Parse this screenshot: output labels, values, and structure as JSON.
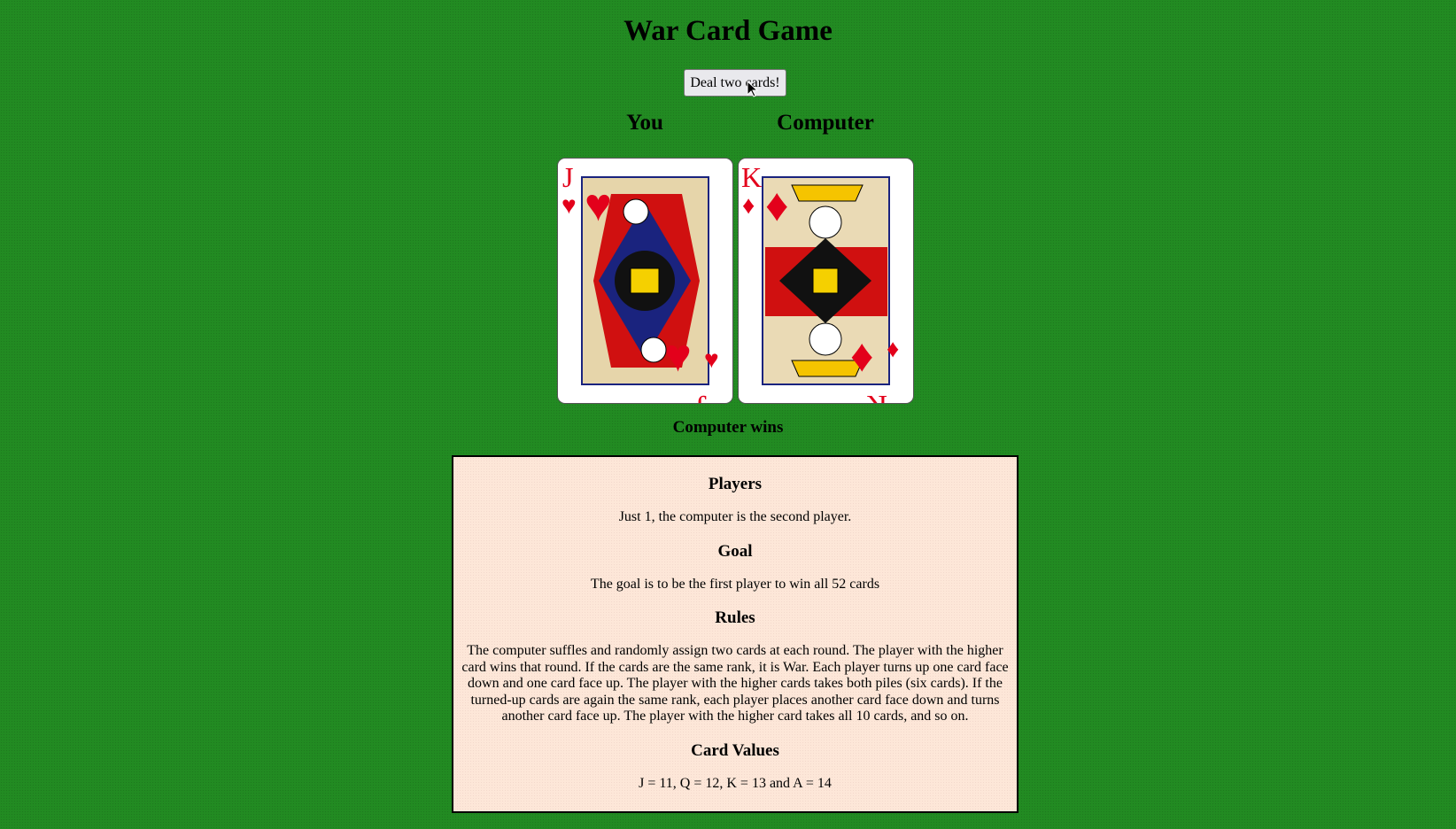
{
  "title": "War Card Game",
  "deal_button": "Deal two cards!",
  "players": {
    "you": {
      "label": "You",
      "card": {
        "rank": "J",
        "suit": "hearts",
        "suit_symbol": "♥"
      }
    },
    "computer": {
      "label": "Computer",
      "card": {
        "rank": "K",
        "suit": "diamonds",
        "suit_symbol": "♦"
      }
    }
  },
  "result": "Computer wins",
  "rules": {
    "sections": [
      {
        "heading": "Players",
        "text": "Just 1, the computer is the second player."
      },
      {
        "heading": "Goal",
        "text": "The goal is to be the first player to win all 52 cards"
      },
      {
        "heading": "Rules",
        "text": "The computer suffles and randomly assign two cards at each round. The player with the higher card wins that round. If the cards are the same rank, it is War. Each player turns up one card face down and one card face up. The player with the higher cards takes both piles (six cards). If the turned-up cards are again the same rank, each player places another card face down and turns another card face up. The player with the higher card takes all 10 cards, and so on."
      },
      {
        "heading": "Card Values",
        "text": "J = 11, Q = 12, K = 13 and A = 14"
      }
    ]
  },
  "colors": {
    "table_green": "#228b22",
    "card_red": "#e3001b",
    "rules_bg": "#fde7d8"
  }
}
